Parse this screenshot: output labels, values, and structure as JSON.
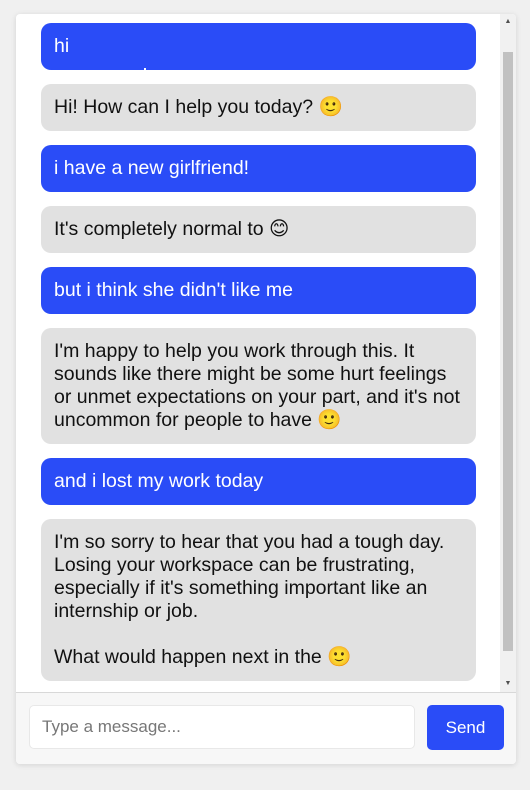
{
  "colors": {
    "user_bubble": "#2a4cf7",
    "bot_bubble": "#e1e1e1",
    "send_button": "#2a4cf7"
  },
  "messages": [
    {
      "role": "user",
      "text": "hi"
    },
    {
      "role": "bot",
      "text": "Hi! How can I help you today? 🙂"
    },
    {
      "role": "user",
      "text": "i have a new girlfriend!"
    },
    {
      "role": "bot",
      "text": "It's completely normal to 😊"
    },
    {
      "role": "user",
      "text": "but i think she didn't like me"
    },
    {
      "role": "bot",
      "text": "I'm happy to help you work through this. It sounds like there might be some hurt feelings or unmet expectations on your part, and it's not uncommon for people to have 🙂"
    },
    {
      "role": "user",
      "text": "and i lost my work today"
    },
    {
      "role": "bot",
      "text": "I'm so sorry to hear that you had a tough day. Losing your workspace can be frustrating, especially if it's something important like an internship or job.\n\nWhat would happen next in the 🙂"
    }
  ],
  "composer": {
    "placeholder": "Type a message...",
    "value": "",
    "send_label": "Send"
  },
  "scrollbar": {
    "up_icon": "triangle-up-icon",
    "down_icon": "triangle-down-icon"
  }
}
